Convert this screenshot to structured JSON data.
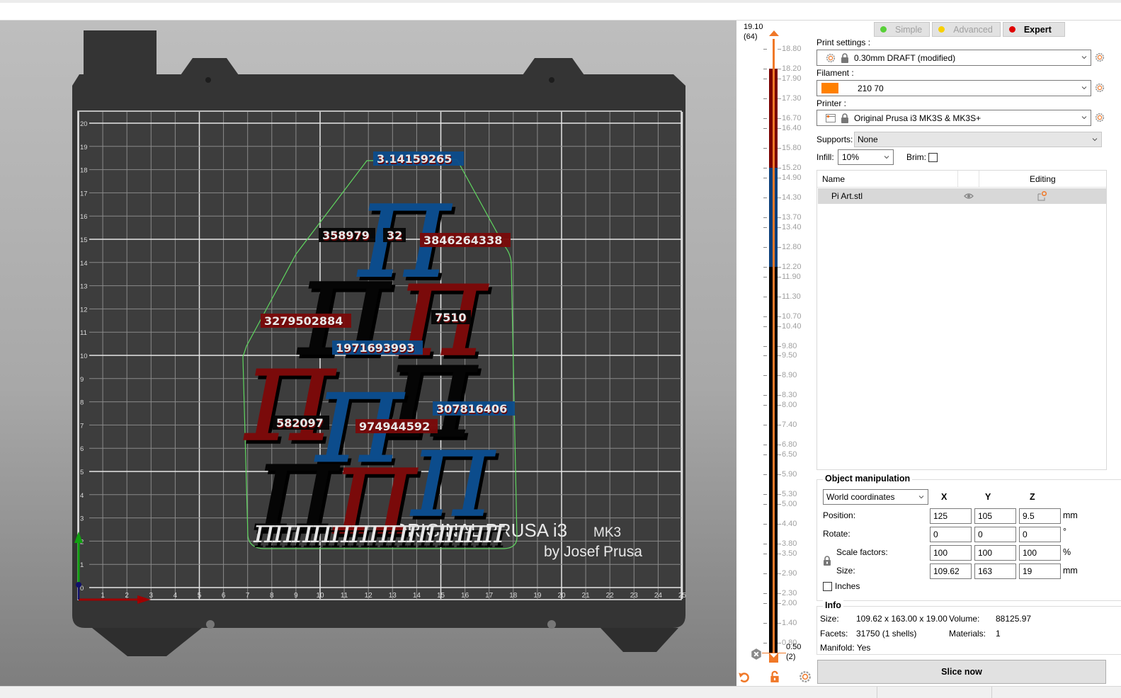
{
  "viewport": {
    "bed_label_line1": "ORIGINAL PRUSA i3",
    "bed_label_mk": "MK3",
    "bed_label_line2": "by Josef Prusa",
    "x_ticks": [
      "1",
      "2",
      "3",
      "4",
      "5",
      "6",
      "7",
      "8",
      "9",
      "10",
      "11",
      "12",
      "13",
      "14",
      "15",
      "16",
      "17",
      "18",
      "19",
      "20",
      "21",
      "22",
      "23",
      "24",
      "25"
    ],
    "y_ticks": [
      "0",
      "1",
      "2",
      "3",
      "4",
      "5",
      "6",
      "7",
      "8",
      "9",
      "10",
      "11",
      "12",
      "13",
      "14",
      "15",
      "16",
      "17",
      "18",
      "19",
      "20"
    ],
    "model_digits": [
      {
        "text": "3.14159265",
        "color": "blue"
      },
      {
        "text": "358979",
        "color": "black"
      },
      {
        "text": "32",
        "color": "black"
      },
      {
        "text": "3846264338",
        "color": "red"
      },
      {
        "text": "3279502884",
        "color": "red"
      },
      {
        "text": "7510",
        "color": "black"
      },
      {
        "text": "1971693993",
        "color": "blue"
      },
      {
        "text": "582097",
        "color": "black"
      },
      {
        "text": "974944592",
        "color": "red"
      },
      {
        "text": "307816406",
        "color": "blue"
      }
    ],
    "colors": {
      "red": "#7a0a0a",
      "blue": "#0c4c8c",
      "black": "#050505",
      "bed": "#343434",
      "grid": "#3d3d3d"
    }
  },
  "layer_slider": {
    "top_value": "19.10",
    "top_layer": "(64)",
    "bottom_value": "0.50",
    "bottom_layer": "(2)",
    "ticks": [
      "18.80",
      "18.20",
      "17.90",
      "17.30",
      "16.70",
      "16.40",
      "15.80",
      "15.20",
      "14.90",
      "14.30",
      "13.70",
      "13.40",
      "12.80",
      "12.20",
      "11.90",
      "11.30",
      "10.70",
      "10.40",
      "9.80",
      "9.50",
      "8.90",
      "8.30",
      "8.00",
      "7.40",
      "6.80",
      "6.50",
      "5.90",
      "5.30",
      "5.00",
      "4.40",
      "3.80",
      "3.50",
      "2.90",
      "2.30",
      "2.00",
      "1.40",
      "0.80",
      "0.50"
    ],
    "segments": [
      {
        "from": 18.2,
        "to": 15.2,
        "color": "#7a0000"
      },
      {
        "from": 15.2,
        "to": 12.2,
        "color": "#0a3f7a"
      },
      {
        "from": 12.2,
        "to": 0.5,
        "color": "#000000"
      }
    ],
    "accent": "#f07828"
  },
  "sidebar": {
    "modes": [
      {
        "label": "Simple",
        "dot": "#58d038",
        "active": false
      },
      {
        "label": "Advanced",
        "dot": "#f8d000",
        "active": false
      },
      {
        "label": "Expert",
        "dot": "#e00000",
        "active": true
      }
    ],
    "print_settings_label": "Print settings :",
    "print_settings_value": "0.30mm DRAFT (modified)",
    "filament_label": "Filament :",
    "filament_value": "210 70",
    "filament_color": "#ff8000",
    "printer_label": "Printer :",
    "printer_value": "Original Prusa i3 MK3S & MK3S+",
    "supports_label": "Supports:",
    "supports_value": "None",
    "infill_label": "Infill:",
    "infill_value": "10%",
    "brim_label": "Brim:",
    "brim_checked": false,
    "object_list": {
      "col_name": "Name",
      "col_editing": "Editing",
      "rows": [
        {
          "name": "Pi Art.stl"
        }
      ]
    },
    "object_manipulation": {
      "title": "Object manipulation",
      "coord_system": "World coordinates",
      "axes": [
        "X",
        "Y",
        "Z"
      ],
      "position_label": "Position:",
      "position": [
        "125",
        "105",
        "9.5"
      ],
      "position_unit": "mm",
      "rotate_label": "Rotate:",
      "rotate": [
        "0",
        "0",
        "0"
      ],
      "rotate_unit": "°",
      "scale_label": "Scale factors:",
      "scale": [
        "100",
        "100",
        "100"
      ],
      "scale_unit": "%",
      "size_label": "Size:",
      "size": [
        "109.62",
        "163",
        "19"
      ],
      "size_unit": "mm",
      "inches_label": "Inches",
      "inches_checked": false
    },
    "info": {
      "title": "Info",
      "size_label": "Size:",
      "size_value": "109.62 x 163.00 x 19.00",
      "volume_label": "Volume:",
      "volume_value": "88125.97",
      "facets_label": "Facets:",
      "facets_value": "31750 (1 shells)",
      "materials_label": "Materials:",
      "materials_value": "1",
      "manifold_label": "Manifold:",
      "manifold_value": "Yes"
    },
    "slice_button": "Slice now"
  }
}
